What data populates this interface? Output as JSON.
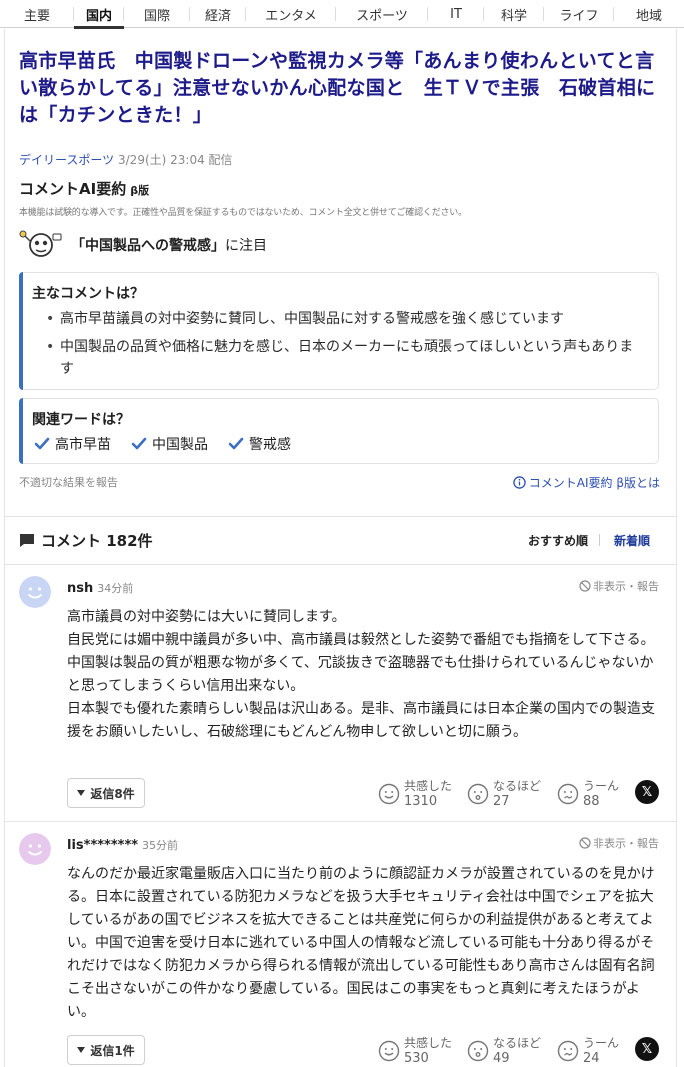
{
  "nav": {
    "tabs": [
      {
        "label": "主要",
        "active": false
      },
      {
        "label": "国内",
        "active": true
      },
      {
        "label": "国際",
        "active": false
      },
      {
        "label": "経済",
        "active": false
      },
      {
        "label": "エンタメ",
        "active": false
      },
      {
        "label": "スポーツ",
        "active": false
      },
      {
        "label": "IT",
        "active": false
      },
      {
        "label": "科学",
        "active": false
      },
      {
        "label": "ライフ",
        "active": false
      },
      {
        "label": "地域",
        "active": false
      }
    ]
  },
  "article": {
    "headline": "高市早苗氏　中国製ドローンや監視カメラ等「あんまり使わんといてと言い散らかしてる」注意せないかん心配な国と　生ＴＶで主張　石破首相には「カチンときた！」",
    "source": "デイリースポーツ",
    "datetime": "3/29(土) 23:04 配信"
  },
  "ai_summary": {
    "title": "コメントAI要約",
    "beta": "β版",
    "disclaimer": "本機能は試験的な導入です。正確性や品質を保証するものではないため、コメント全文と併せてご確認ください。",
    "focus_keyword": "「中国製品への警戒感」",
    "focus_suffix": "に注目",
    "main_heading": "主なコメントは？",
    "main_points": [
      "高市早苗議員の対中姿勢に賛同し、中国製品に対する警戒感を強く感じています",
      "中国製品の品質や価格に魅力を感じ、日本のメーカーにも頑張ってほしいという声もあります"
    ],
    "related_heading": "関連ワードは？",
    "related_words": [
      "高市早苗",
      "中国製品",
      "警戒感"
    ],
    "report_link": "不適切な結果を報告",
    "about_link": "コメントAI要約 β版とは"
  },
  "comments_section": {
    "title": "コメント 182件",
    "sort_recommended": "おすすめ順",
    "sort_newest": "新着順",
    "hide_report": "非表示・報告",
    "reaction_labels": {
      "agree": "共感した",
      "insight": "なるほど",
      "hmm": "うーん"
    },
    "comments": [
      {
        "user": "nsh",
        "time": "34分前",
        "avatar_color": "#c9d5f5",
        "body": "高市議員の対中姿勢には大いに賛同します。\n自民党には媚中親中議員が多い中、高市議員は毅然とした姿勢で番組でも指摘をして下さる。\n中国製は製品の質が粗悪な物が多くて、冗談抜きで盗聴器でも仕掛けられているんじゃないかと思ってしまうくらい信用出来ない。\n日本製でも優れた素晴らしい製品は沢山ある。是非、高市議員には日本企業の国内での製造支援をお願いしたいし、石破総理にもどんどん物申して欲しいと切に願う。",
        "replies": "返信8件",
        "agree": "1310",
        "insight": "27",
        "hmm": "88"
      },
      {
        "user": "lis********",
        "time": "35分前",
        "avatar_color": "#e6c9ec",
        "body": "なんのだか最近家電量販店入口に当たり前のように顔認証カメラが設置されているのを見かける。日本に設置されている防犯カメラなどを扱う大手セキュリティ会社は中国でシェアを拡大しているがあの国でビジネスを拡大できることは共産党に何らかの利益提供があると考えてよい。中国で迫害を受け日本に逃れている中国人の情報など流している可能も十分あり得るがそれだけではなく防犯カメラから得られる情報が流出している可能性もあり高市さんは固有名詞こそ出さないがこの件かなり憂慮している。国民はこの事実をもっと真剣に考えたほうがよい。",
        "replies": "返信1件",
        "agree": "530",
        "insight": "49",
        "hmm": "24"
      }
    ]
  },
  "colors": {
    "headline": "#1d1a8a",
    "accent": "#3b6fc4",
    "link": "#2d4fb1"
  }
}
